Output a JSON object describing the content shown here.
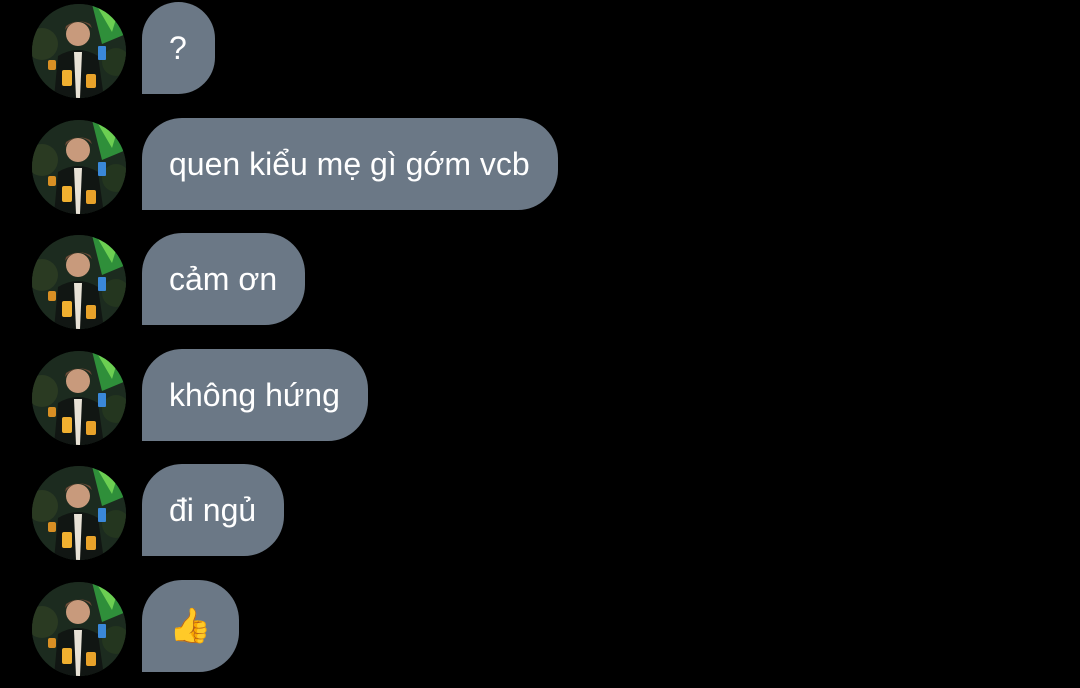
{
  "colors": {
    "background": "#000000",
    "bubble": "#6b7886",
    "text": "#ffffff"
  },
  "avatar": {
    "icon": "profile-photo-avatar"
  },
  "messages": [
    {
      "text": "?"
    },
    {
      "text": "quen kiểu mẹ gì gớm vcb"
    },
    {
      "text": "cảm ơn"
    },
    {
      "text": "không hứng"
    },
    {
      "text": "đi ngủ"
    },
    {
      "text": "👍",
      "icon": "thumbs-up-icon"
    }
  ]
}
